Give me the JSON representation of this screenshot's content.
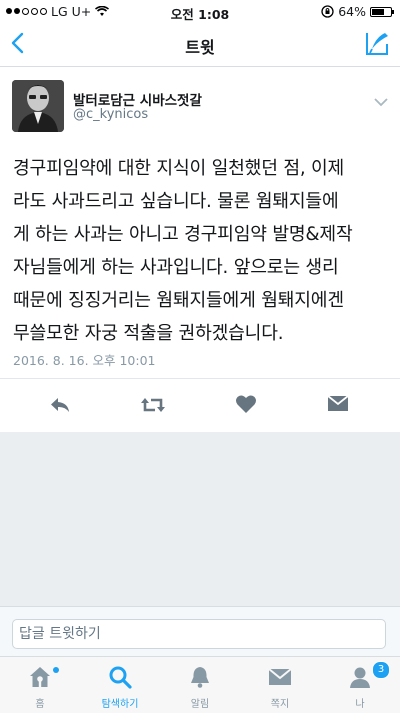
{
  "status_bar": {
    "carrier": "LG U+",
    "time": "오전 1:08",
    "battery": "64%",
    "battery_level": 0.64
  },
  "nav": {
    "title": "트윗"
  },
  "tweet": {
    "display_name": "발터로담근 시바스젓갈",
    "handle": "@c_kynicos",
    "text": "경구피임약에 대한 지식이 일천했던 점, 이제\n라도 사과드리고 싶습니다. 물론 웜퇘지들에\n게 하는 사과는 아니고 경구피임약 발명&제작\n자님들에게 하는 사과입니다. 앞으로는 생리\n때문에 징징거리는 웜퇘지들에게 웜퇘지에겐\n무쓸모한 자궁 적출을 권하겠습니다.",
    "timestamp": "2016. 8. 16. 오후 10:01"
  },
  "reply": {
    "placeholder": "답글 트윗하기"
  },
  "tabs": [
    {
      "label": "홈"
    },
    {
      "label": "탐색하기"
    },
    {
      "label": "알림"
    },
    {
      "label": "쪽지"
    },
    {
      "label": "나",
      "badge": "3"
    }
  ],
  "colors": {
    "accent": "#1da1f2",
    "icon_gray": "#66757f"
  }
}
